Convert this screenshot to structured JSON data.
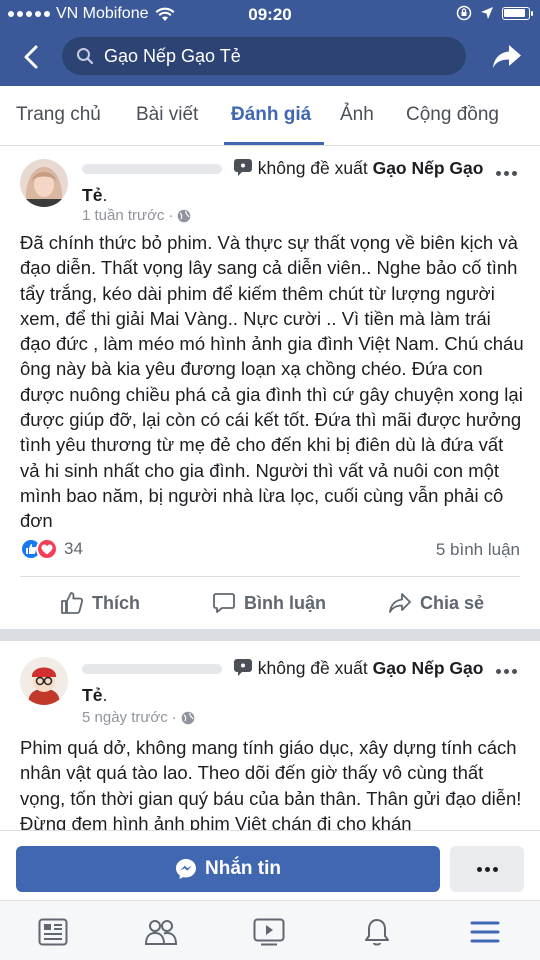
{
  "status_bar": {
    "carrier": "VN Mobifone",
    "time": "09:20",
    "battery_level": 0.9
  },
  "search": {
    "query": "Gạo Nếp Gạo Tẻ"
  },
  "tabs": [
    {
      "label": "Trang chủ",
      "active": false
    },
    {
      "label": "Bài viết",
      "active": false
    },
    {
      "label": "Đánh giá",
      "active": true
    },
    {
      "label": "Ảnh",
      "active": false
    },
    {
      "label": "Cộng đồng",
      "active": false
    }
  ],
  "posts": [
    {
      "recommend_text": "không đề xuất",
      "page_name": "Gạo Nếp Gạo Tẻ",
      "page_name_suffix": ".",
      "time": "1 tuần trước",
      "body": "Đã chính thức bỏ phim. Và thực sự thất vọng về biên kịch và đạo diễn. Thất vọng lây sang cả diễn viên.. Nghe bảo cố tình tẩy trắng, kéo dài phim để kiếm thêm chút từ lượng người xem, để thi giải Mai Vàng.. Nực cười .. Vì tiền mà làm trái đạo đức , làm méo mó hình ảnh gia đình Việt Nam. Chú cháu ông này bà kia yêu đương loạn xạ chồng chéo. Đứa con được nuông chiều phá cả gia đình thì cứ gây chuyện xong lại được giúp đỡ, lại còn có cái kết tốt. Đứa thì mãi        được hưởng tình yêu thương từ mẹ đẻ cho đến khi bị điên dù là đứa vất vả hi sinh nhất cho gia đình. Người thì vất vả nuôi con một mình bao năm, bị người nhà lừa lọc, cuối cùng vẫn phải cô đơn",
      "reactions_count": "34",
      "comments_count": "5 bình luận",
      "like_label": "Thích",
      "comment_label": "Bình luận",
      "share_label": "Chia sẻ"
    },
    {
      "recommend_text": "không đề xuất",
      "page_name": "Gạo Nếp Gạo Tẻ",
      "page_name_suffix": ".",
      "time": "5 ngày trước",
      "body": "Phim quá dở, không mang tính giáo dục, xây dựng tính cách nhân vật quá tào lao. Theo dõi đến giờ thấy vô cùng thất vọng, tốn thời gian quý báu của bản thân. Thân gửi đạo diễn! Đừng đem hình ảnh phim Việt chán đi cho khán"
    }
  ],
  "message_bar": {
    "message_label": "Nhắn tin"
  },
  "colors": {
    "brand": "#3b5998",
    "accent": "#4267b2"
  }
}
